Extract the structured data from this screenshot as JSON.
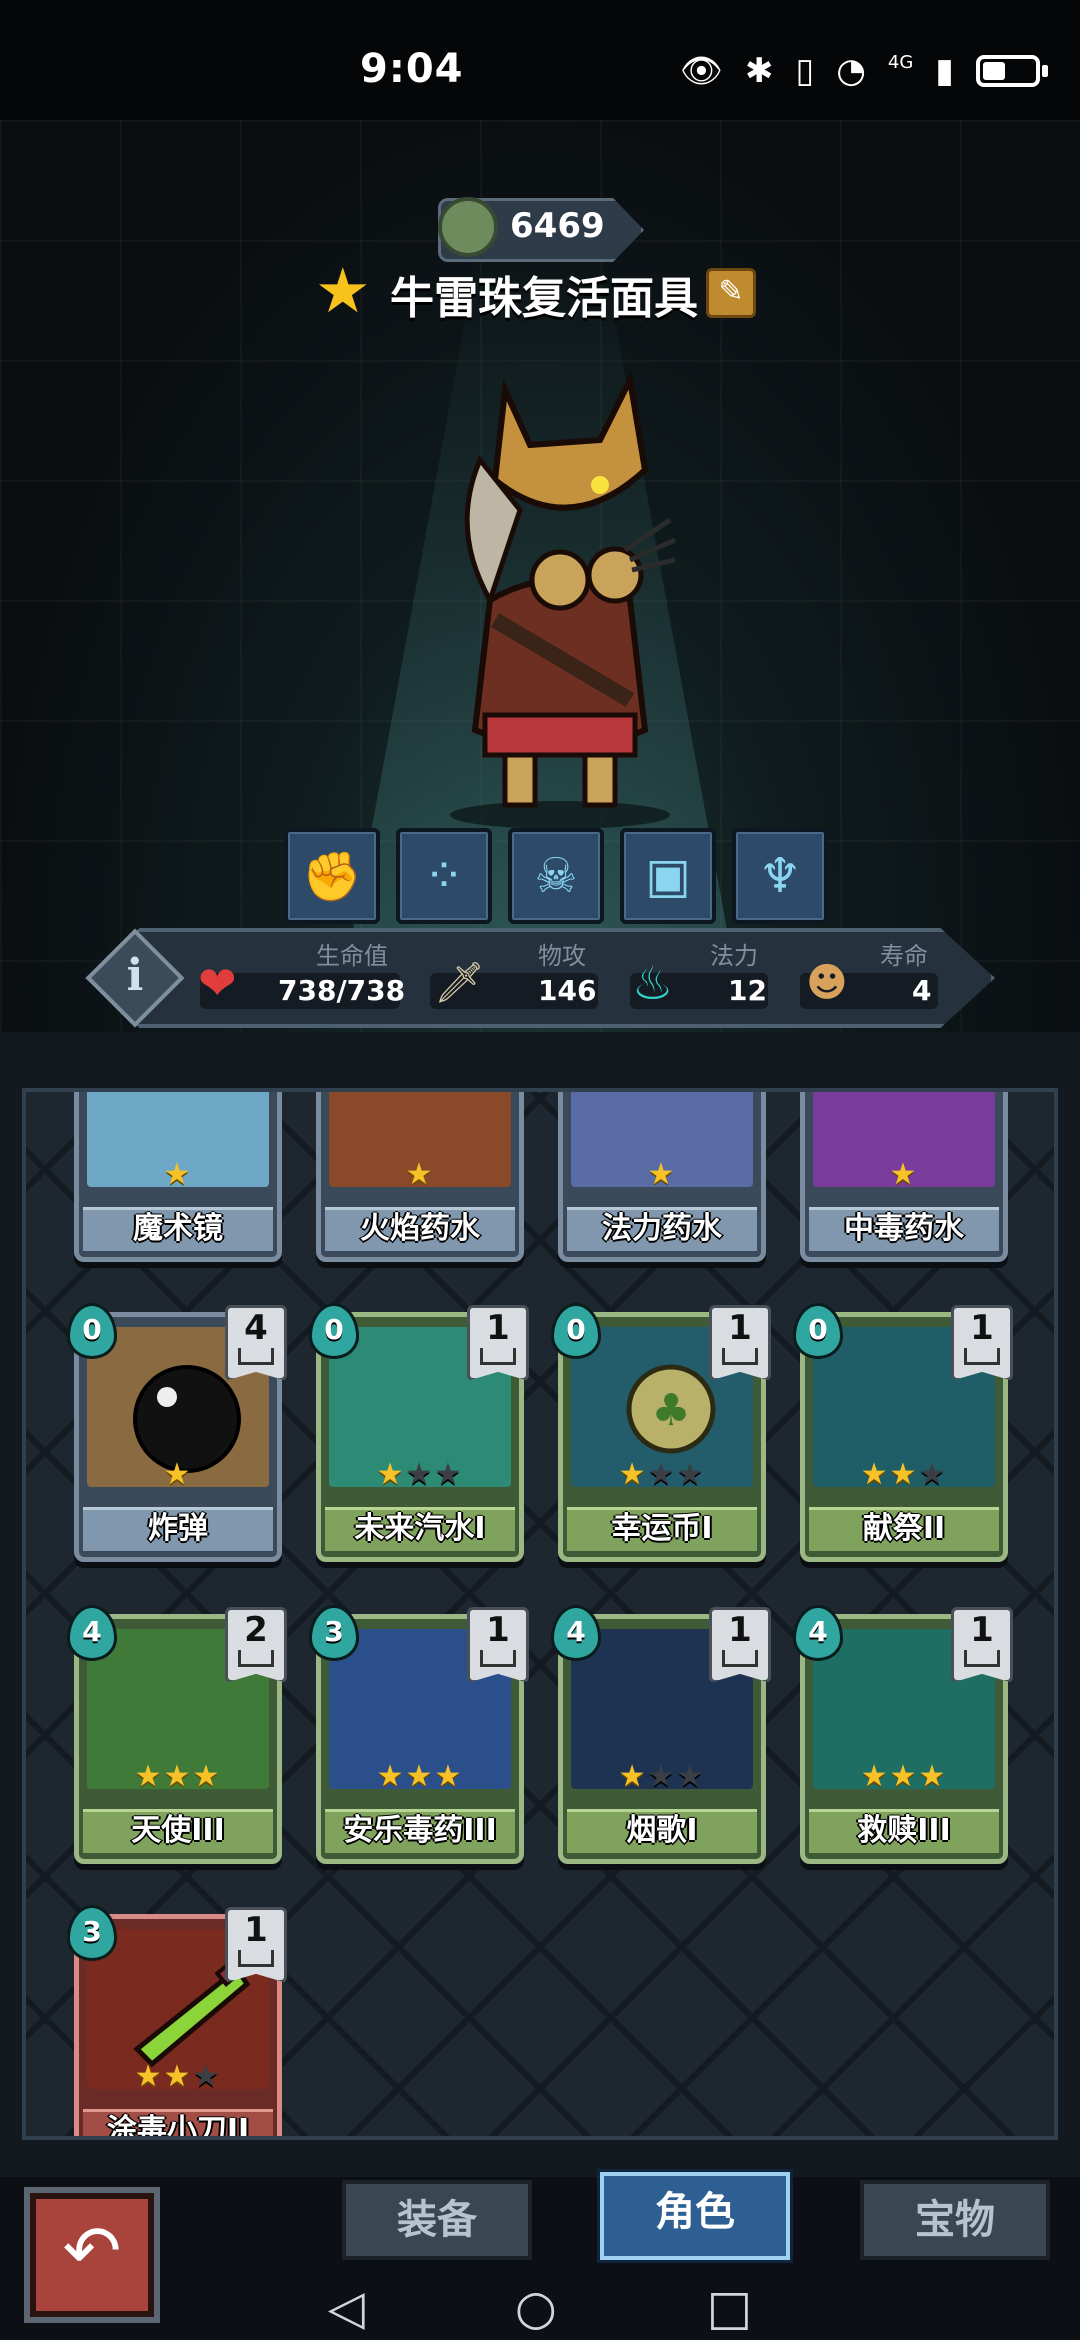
{
  "status": {
    "time": "9:04",
    "network": "4G"
  },
  "hero": {
    "currency_value": "6469",
    "name": "牛雷珠复活面具"
  },
  "stats": {
    "hp_label": "生命值",
    "hp_value": "738/738",
    "atk_label": "物攻",
    "atk_value": "146",
    "mana_label": "法力",
    "mana_value": "12",
    "life_label": "寿命",
    "life_value": "4"
  },
  "cards": [
    {
      "name": "魔术镜",
      "stars_on": 1,
      "stars_total": 1
    },
    {
      "name": "火焰药水",
      "stars_on": 1,
      "stars_total": 1
    },
    {
      "name": "法力药水",
      "stars_on": 1,
      "stars_total": 1
    },
    {
      "name": "中毒药水",
      "stars_on": 1,
      "stars_total": 1
    },
    {
      "name": "炸弹",
      "cost": "0",
      "count": "4",
      "stars_on": 1,
      "stars_total": 1
    },
    {
      "name": "未来汽水I",
      "cost": "0",
      "count": "1",
      "stars_on": 1,
      "stars_total": 3
    },
    {
      "name": "幸运币I",
      "cost": "0",
      "count": "1",
      "stars_on": 1,
      "stars_total": 3
    },
    {
      "name": "献祭II",
      "cost": "0",
      "count": "1",
      "stars_on": 2,
      "stars_total": 3
    },
    {
      "name": "天使III",
      "cost": "4",
      "count": "2",
      "stars_on": 3,
      "stars_total": 3
    },
    {
      "name": "安乐毒药III",
      "cost": "3",
      "count": "1",
      "stars_on": 3,
      "stars_total": 3
    },
    {
      "name": "烟歌I",
      "cost": "4",
      "count": "1",
      "stars_on": 1,
      "stars_total": 3
    },
    {
      "name": "救赎III",
      "cost": "4",
      "count": "1",
      "stars_on": 3,
      "stars_total": 3
    },
    {
      "name": "涂毒小刀II",
      "cost": "3",
      "count": "1",
      "stars_on": 2,
      "stars_total": 3
    }
  ],
  "tabs": {
    "equip": "装备",
    "role": "角色",
    "treasure": "宝物"
  },
  "colors": {
    "accent": "#2e5f92",
    "star": "#f6c228",
    "mana": "#2fa7a0"
  }
}
